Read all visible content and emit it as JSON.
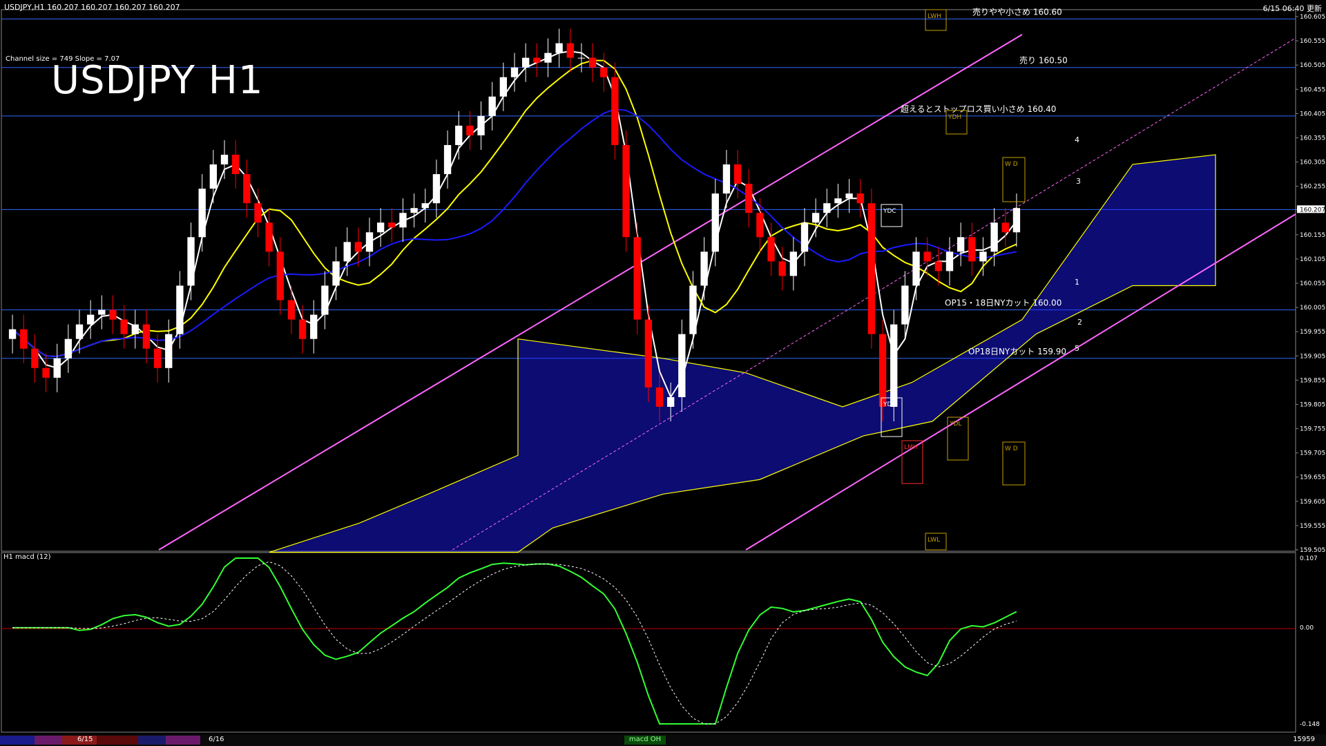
{
  "header": {
    "info": "USDJPY,H1 160.207 160.207 160.207 160.207",
    "time": "6/15 06:40 更新"
  },
  "overlay": {
    "channel_info": "Channel size = 749 Slope = 7.07",
    "title": "USDJPY H1"
  },
  "macd_panel": {
    "label": "H1 macd (12)",
    "axis": [
      "0.107",
      "0.00",
      "-0.148"
    ]
  },
  "price_axis": [
    "160.605",
    "160.555",
    "160.505",
    "160.455",
    "160.405",
    "160.355",
    "160.305",
    "160.255",
    "160.207",
    "160.155",
    "160.105",
    "160.055",
    "160.005",
    "159.955",
    "159.905",
    "159.855",
    "159.805",
    "159.755",
    "159.705",
    "159.655",
    "159.605",
    "159.555",
    "159.505"
  ],
  "annotations": [
    {
      "text": "売りやや小さめ 160.60",
      "price": 160.6
    },
    {
      "text": "売り 160.50",
      "price": 160.5
    },
    {
      "text": "超えるとストップロス買い小さめ 160.40",
      "price": 160.4
    },
    {
      "text": "OP15・18日NYカット 160.00",
      "price": 160.0
    },
    {
      "text": "OP18日NYカット 159.90",
      "price": 159.9
    }
  ],
  "labels": {
    "ydc": "YDC",
    "ydo": "YDO",
    "ydh": "YDH",
    "ydl": "YDL",
    "lwh": "LWH",
    "lwl": "LWL",
    "lmh": "LMH",
    "w": "W",
    "d": "D",
    "wave": [
      "1",
      "2",
      "3",
      "4",
      "5"
    ]
  },
  "bottom_bar": {
    "dates": [
      "6/15",
      "6/16"
    ],
    "status": "macd OH",
    "right": "15959"
  },
  "colors": {
    "bull": "#ffffff",
    "bear": "#ff0000",
    "ma_fast": "#ffffff",
    "ma_mid": "#ffff00",
    "ma_slow": "#1a1aff",
    "kumo": "#1a1aff",
    "channel": "#ff66ff",
    "level": "#3366ff",
    "macd": "#33ff33",
    "signal": "#ffffff"
  },
  "chart_data": {
    "type": "candlestick",
    "title": "USDJPY H1",
    "timeframe": "H1",
    "ylim": [
      159.505,
      160.605
    ],
    "last_price": 160.207,
    "levels": [
      160.6,
      160.5,
      160.4,
      160.207,
      160.0,
      159.9
    ],
    "date_labels": [
      "6/15",
      "6/16"
    ],
    "series": [
      {
        "name": "USDJPY",
        "close": [
          159.96,
          159.92,
          159.88,
          159.86,
          159.9,
          159.94,
          159.97,
          159.99,
          160.0,
          159.98,
          159.95,
          159.97,
          159.92,
          159.88,
          159.95,
          160.05,
          160.15,
          160.25,
          160.3,
          160.32,
          160.28,
          160.22,
          160.18,
          160.12,
          160.02,
          159.98,
          159.94,
          159.99,
          160.05,
          160.1,
          160.14,
          160.12,
          160.16,
          160.18,
          160.17,
          160.2,
          160.21,
          160.22,
          160.28,
          160.34,
          160.38,
          160.36,
          160.4,
          160.44,
          160.48,
          160.5,
          160.52,
          160.51,
          160.53,
          160.55,
          160.52,
          160.52,
          160.5,
          160.48,
          160.34,
          160.15,
          159.98,
          159.84,
          159.8,
          159.82,
          159.95,
          160.05,
          160.12,
          160.24,
          160.3,
          160.26,
          160.2,
          160.15,
          160.1,
          160.07,
          160.12,
          160.18,
          160.2,
          160.22,
          160.23,
          160.24,
          160.22,
          159.95,
          159.8,
          159.97,
          160.05,
          160.12,
          160.1,
          160.08,
          160.12,
          160.15,
          160.1,
          160.12,
          160.18,
          160.16,
          160.21
        ]
      }
    ],
    "macd": {
      "range": [
        -0.148,
        0.107
      ],
      "zero": 0.0
    }
  }
}
